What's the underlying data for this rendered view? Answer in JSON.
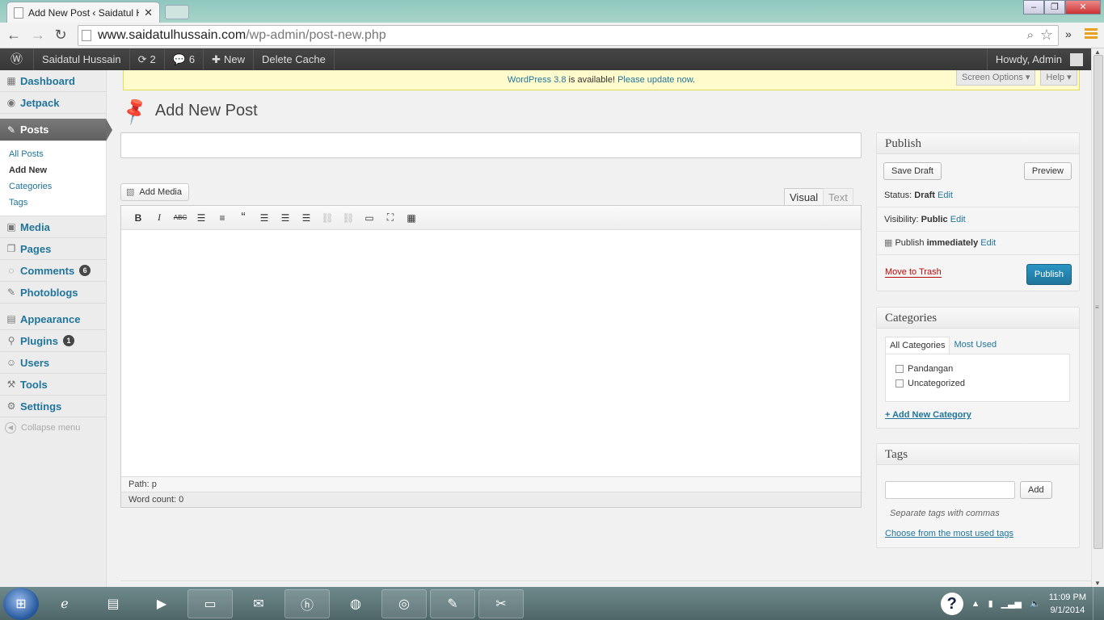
{
  "browser": {
    "tab_title": "Add New Post ‹ Saidatul H",
    "url_domain": "www.saidatulhussain.com",
    "url_path": "/wp-admin/post-new.php"
  },
  "adminbar": {
    "site_name": "Saidatul Hussain",
    "updates_count": "2",
    "comments_count": "6",
    "new_label": "New",
    "delete_cache_label": "Delete Cache",
    "howdy": "Howdy, Admin"
  },
  "sidebar": {
    "dashboard": "Dashboard",
    "jetpack": "Jetpack",
    "posts": "Posts",
    "posts_sub": [
      "All Posts",
      "Add New",
      "Categories",
      "Tags"
    ],
    "media": "Media",
    "pages": "Pages",
    "comments": "Comments",
    "comments_badge": "6",
    "photoblogs": "Photoblogs",
    "appearance": "Appearance",
    "plugins": "Plugins",
    "plugins_badge": "1",
    "users": "Users",
    "tools": "Tools",
    "settings": "Settings",
    "collapse": "Collapse menu"
  },
  "notice": {
    "link1": "WordPress 3.8",
    "middle": " is available! ",
    "link2": "Please update now",
    "end": "."
  },
  "screen_options": "Screen Options ▾",
  "help": "Help ▾",
  "page_title": "Add New Post",
  "editor": {
    "add_media": "Add Media",
    "tab_visual": "Visual",
    "tab_text": "Text",
    "path": "Path: p",
    "word_count": "Word count: 0"
  },
  "publish": {
    "title": "Publish",
    "save_draft": "Save Draft",
    "preview": "Preview",
    "status_label": "Status: ",
    "status_value": "Draft",
    "visibility_label": "Visibility: ",
    "visibility_value": "Public",
    "schedule_label": "Publish ",
    "schedule_value": "immediately",
    "edit": "Edit",
    "move_to_trash": "Move to Trash",
    "publish_button": "Publish"
  },
  "categories": {
    "title": "Categories",
    "tab_all": "All Categories",
    "tab_most_used": "Most Used",
    "items": [
      "Pandangan",
      "Uncategorized"
    ],
    "add_new": "+ Add New Category"
  },
  "tags": {
    "title": "Tags",
    "add_button": "Add",
    "hint": "Separate tags with commas",
    "choose_link": "Choose from the most used tags"
  },
  "taskbar": {
    "time": "11:09 PM",
    "date": "9/1/2014"
  }
}
